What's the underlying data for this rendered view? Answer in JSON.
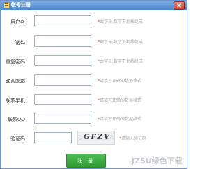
{
  "window": {
    "title": "帐号注册"
  },
  "form": {
    "fields": [
      {
        "label": "用户名：",
        "value": "",
        "hint_star": "*",
        "hint": "由字母,数字下划线组成"
      },
      {
        "label": "密码：",
        "value": "",
        "hint_star": "*",
        "hint": "由字母,数字下划线组成"
      },
      {
        "label": "重复密码：",
        "value": "",
        "hint_star": "*",
        "hint": "由字母,数字下划线组成"
      },
      {
        "label": "联系邮箱：",
        "value": "",
        "hint_star": "*",
        "hint": "请填写正确的数据格式"
      },
      {
        "label": "联系手机：",
        "value": "",
        "hint_star": "*",
        "hint": "请填写正确的数据格式"
      },
      {
        "label": "联系QQ：",
        "value": "",
        "hint_star": "*",
        "hint": "请填写正确的数据格式"
      }
    ],
    "captcha": {
      "label": "验证码：",
      "value": "",
      "image_text": "GFZV",
      "hint_star": "*",
      "hint": "请输入验证码"
    },
    "submit_label": "注 册"
  },
  "watermark": "JZ5U绿色下载",
  "colors": {
    "titlebar": "#4d86cf",
    "submit": "#2f9a36",
    "hint_star": "#e23a3a"
  }
}
